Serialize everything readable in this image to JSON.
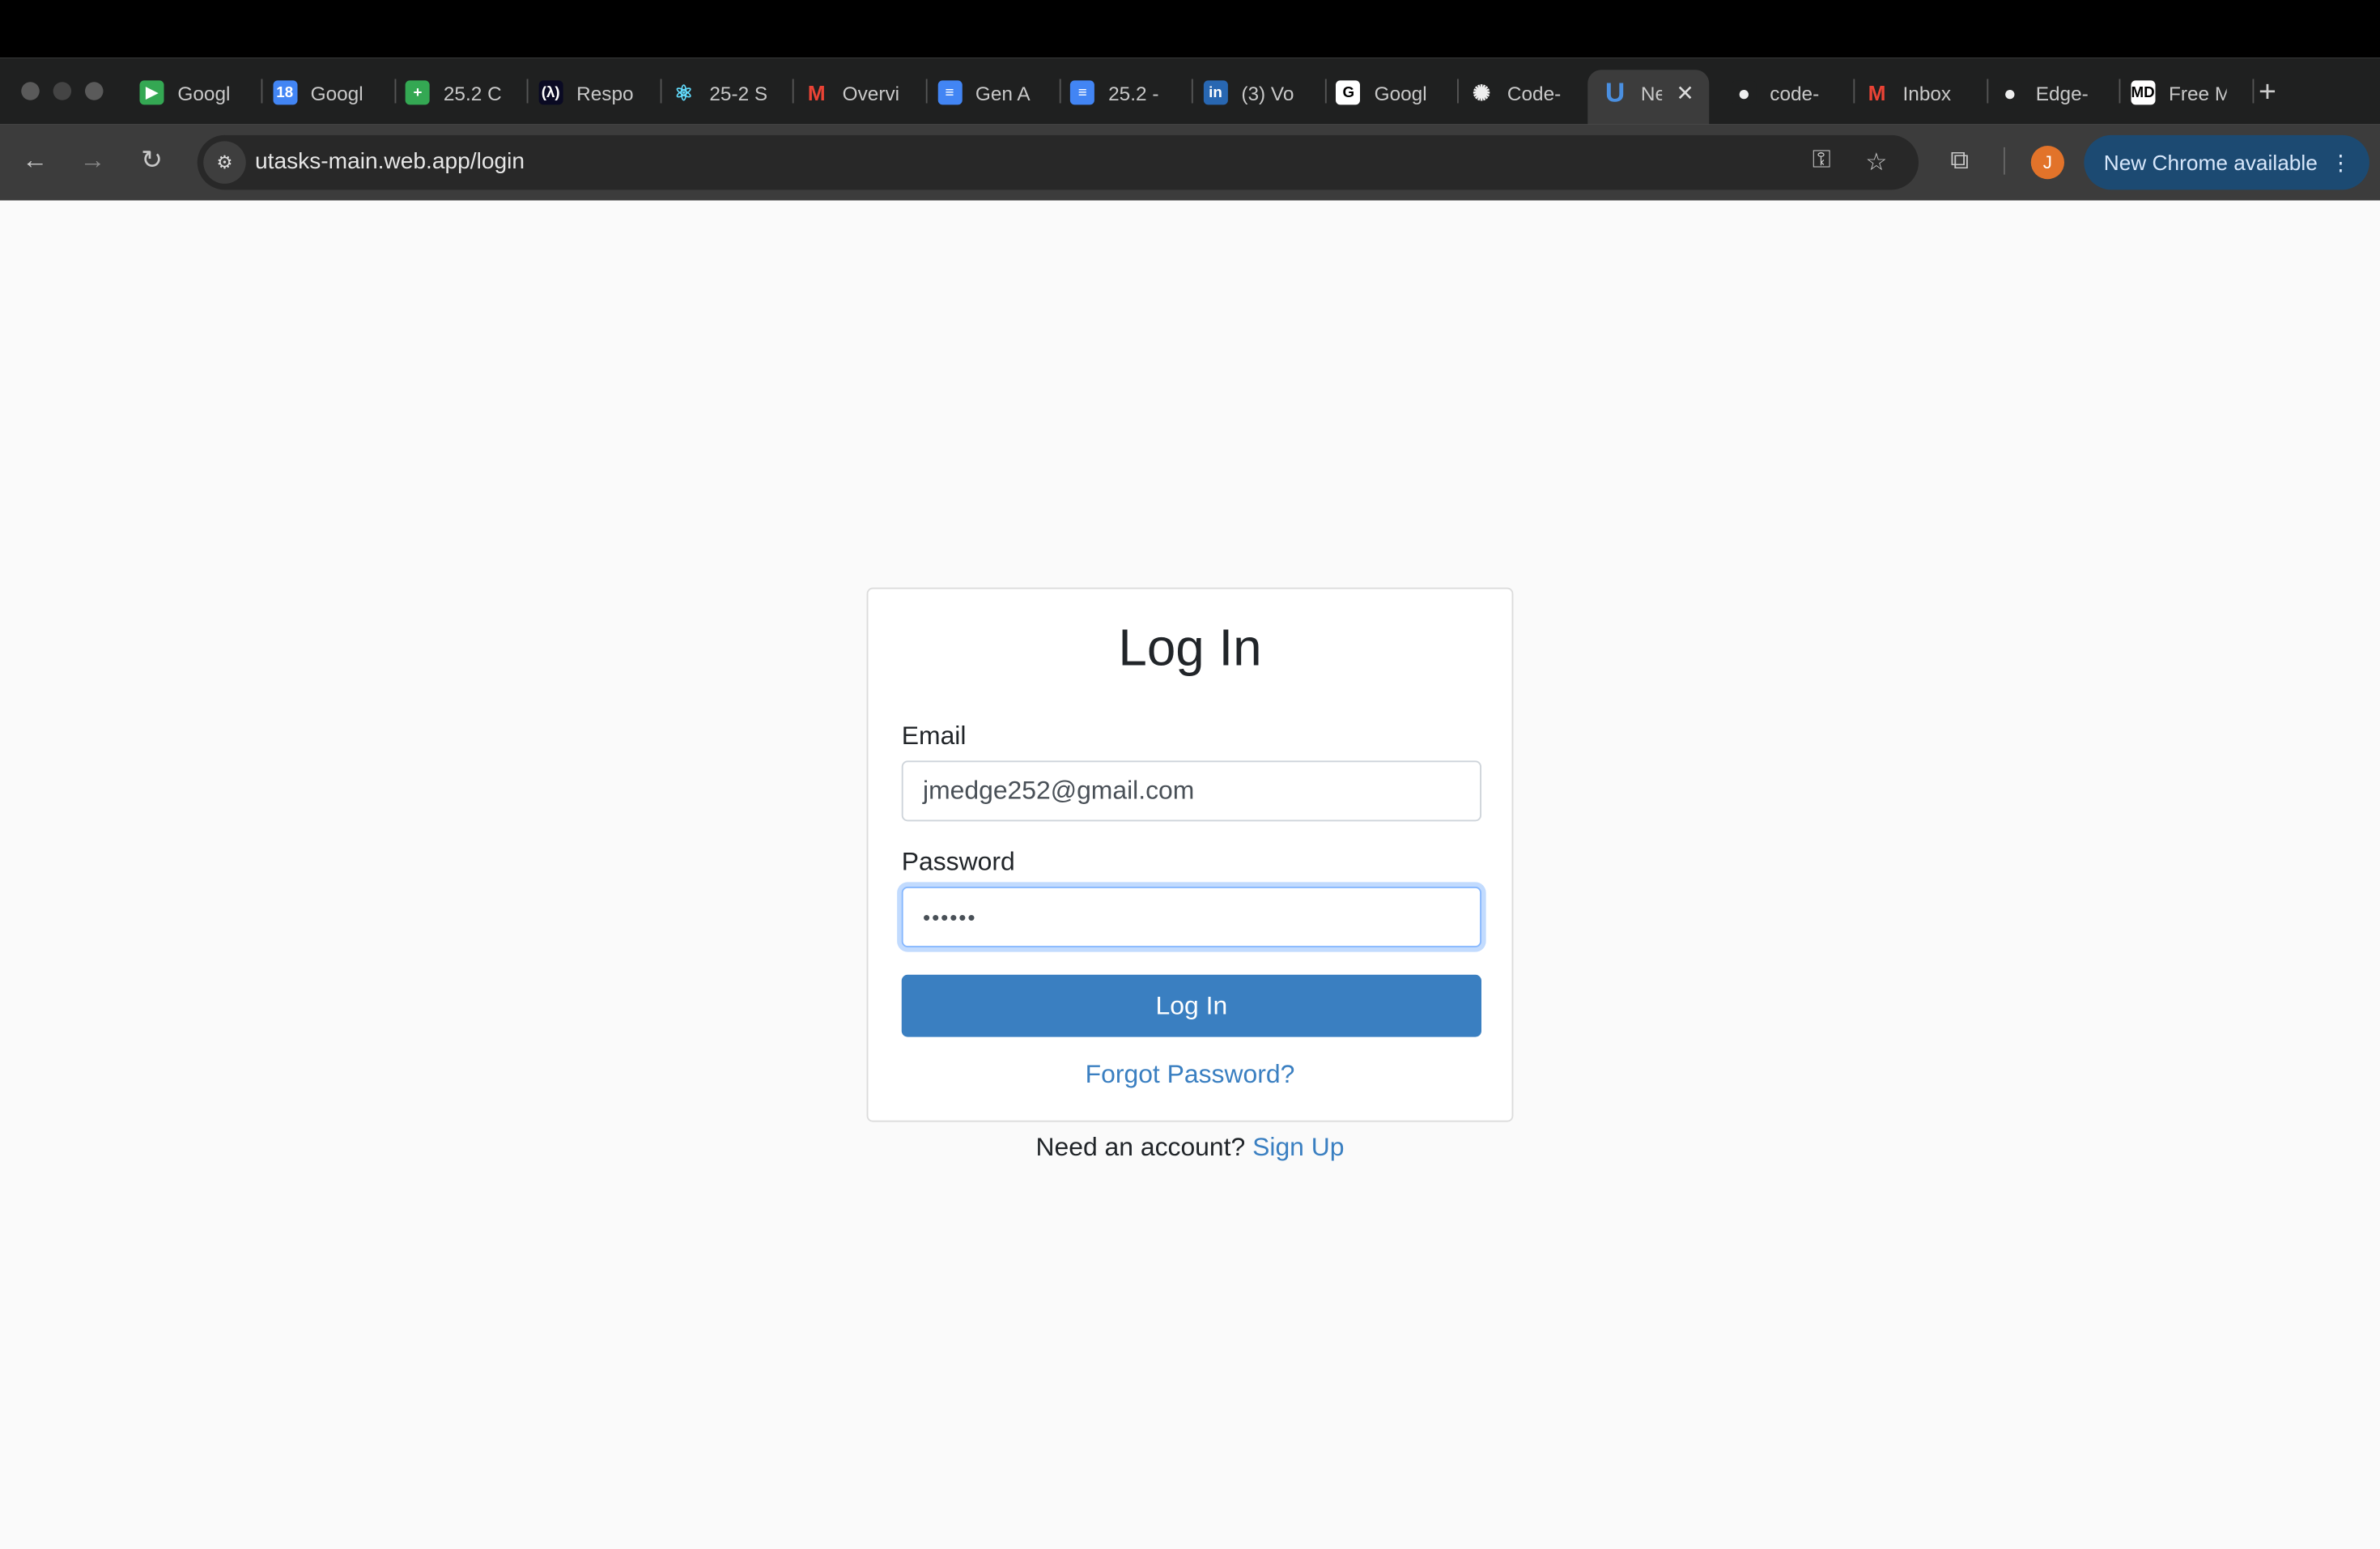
{
  "browser": {
    "tabs": [
      {
        "label": "Googl",
        "icon": "google-meet-icon",
        "color": "#34a853",
        "glyph": "▶"
      },
      {
        "label": "Googl",
        "icon": "google-calendar-icon",
        "color": "#4285f4",
        "glyph": "18"
      },
      {
        "label": "25.2 C",
        "icon": "google-sheets-icon",
        "color": "#34a853",
        "glyph": "+"
      },
      {
        "label": "Respo",
        "icon": "freecodecamp-icon",
        "color": "#0a0a23",
        "glyph": "(λ)"
      },
      {
        "label": "25-2 S",
        "icon": "react-icon",
        "color": "#1f2020",
        "glyph": "⚛"
      },
      {
        "label": "Overvi",
        "icon": "gmail-icon",
        "color": "#1f2020",
        "glyph": "M"
      },
      {
        "label": "Gen A",
        "icon": "google-docs-icon",
        "color": "#4285f4",
        "glyph": "≡"
      },
      {
        "label": "25.2 -",
        "icon": "google-docs-icon",
        "color": "#4285f4",
        "glyph": "≡"
      },
      {
        "label": "(3) Vo",
        "icon": "linkedin-icon",
        "color": "#2867b2",
        "glyph": "in"
      },
      {
        "label": "Googl",
        "icon": "google-icon",
        "color": "#ffffff",
        "glyph": "G"
      },
      {
        "label": "Code-",
        "icon": "openai-icon",
        "color": "#1f2020",
        "glyph": "✺"
      }
    ],
    "active_tab": {
      "label": "Ne",
      "icon": "utasks-icon",
      "glyph": "U"
    },
    "tabs_after": [
      {
        "label": "code-",
        "icon": "github-icon",
        "color": "#1f2020",
        "glyph": "●"
      },
      {
        "label": "Inbox",
        "icon": "gmail-icon",
        "color": "#1f2020",
        "glyph": "M"
      },
      {
        "label": "Edge-",
        "icon": "github-icon",
        "color": "#1f2020",
        "glyph": "●"
      },
      {
        "label": "Free M",
        "icon": "markdown-html-icon",
        "color": "#ffffff",
        "glyph": "MD"
      }
    ],
    "url": "utasks-main.web.app/login",
    "new_chrome": "New Chrome available",
    "profile_initial": "J"
  },
  "login": {
    "title": "Log In",
    "email_label": "Email",
    "email_value": "jmedge252@gmail.com",
    "password_label": "Password",
    "password_value": "••••••",
    "submit": "Log In",
    "forgot": "Forgot Password?",
    "need_account": "Need an account?",
    "signup": "Sign Up"
  },
  "colors": {
    "accent": "#3a7fc1",
    "page_bg": "#fafafa",
    "profile": "#e2732a"
  }
}
